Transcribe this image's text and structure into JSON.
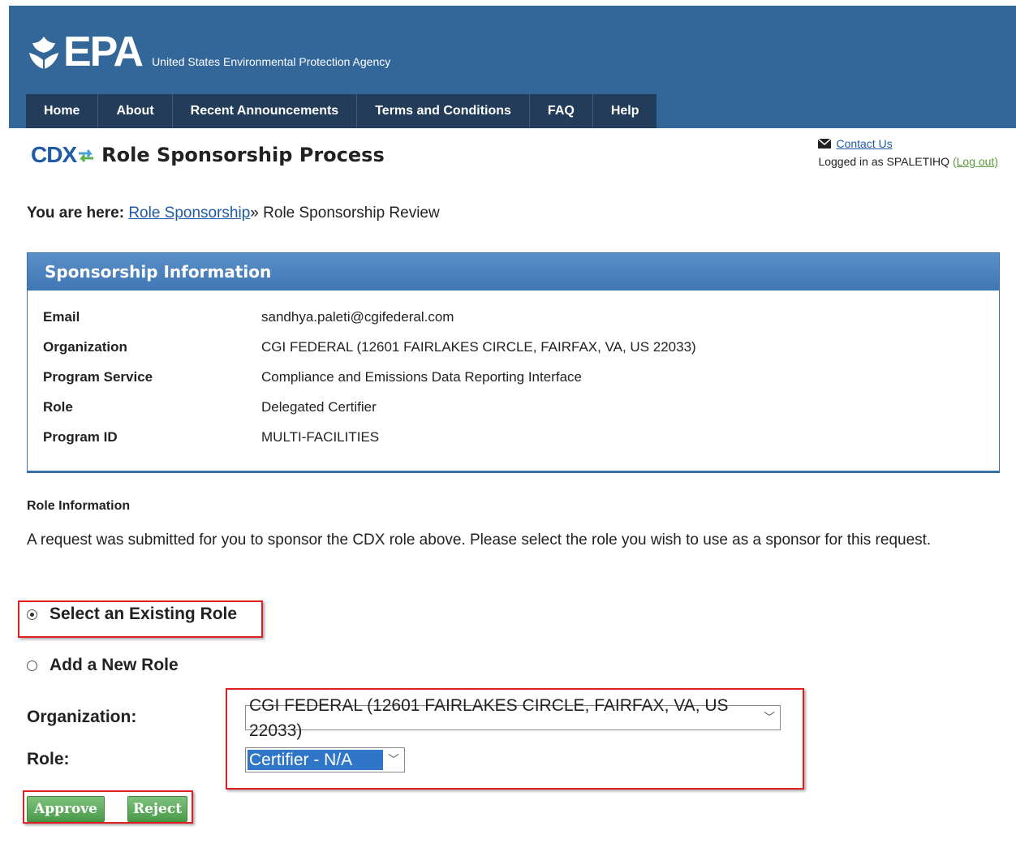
{
  "header": {
    "logo_text": "EPA",
    "agency": "United States Environmental Protection Agency",
    "nav": [
      "Home",
      "About",
      "Recent Announcements",
      "Terms and Conditions",
      "FAQ",
      "Help"
    ]
  },
  "title": {
    "logo": "CDX",
    "text": "Role Sponsorship Process"
  },
  "user": {
    "contact_label": "Contact Us",
    "logged_in_text": "Logged in as SPALETIHQ",
    "logout_label": "(Log out)"
  },
  "breadcrumb": {
    "prefix": "You are here:",
    "link": "Role Sponsorship",
    "separator": "»",
    "current": "Role Sponsorship Review"
  },
  "sponsorship": {
    "heading": "Sponsorship Information",
    "rows": [
      {
        "label": "Email",
        "value": "sandhya.paleti@cgifederal.com"
      },
      {
        "label": "Organization",
        "value": "CGI FEDERAL (12601 FAIRLAKES CIRCLE, FAIRFAX, VA, US 22033)"
      },
      {
        "label": "Program Service",
        "value": "Compliance and Emissions Data Reporting Interface"
      },
      {
        "label": "Role",
        "value": "Delegated Certifier"
      },
      {
        "label": "Program ID",
        "value": "MULTI-FACILITIES"
      }
    ]
  },
  "role_info": {
    "title": "Role Information",
    "description": "A request was submitted for you to sponsor the CDX role above. Please select the role you wish to use as a sponsor for this request."
  },
  "options": {
    "existing": "Select an Existing Role",
    "new": "Add a New Role",
    "selected": "existing"
  },
  "form": {
    "org_label": "Organization:",
    "org_value": "CGI FEDERAL (12601 FAIRLAKES CIRCLE, FAIRFAX, VA, US 22033)",
    "role_label": "Role:",
    "role_value": "Certifier - N/A"
  },
  "buttons": {
    "approve": "Approve",
    "reject": "Reject"
  },
  "colors": {
    "header": "#336699",
    "highlight": "#e02020",
    "button": "#5aa85a"
  }
}
